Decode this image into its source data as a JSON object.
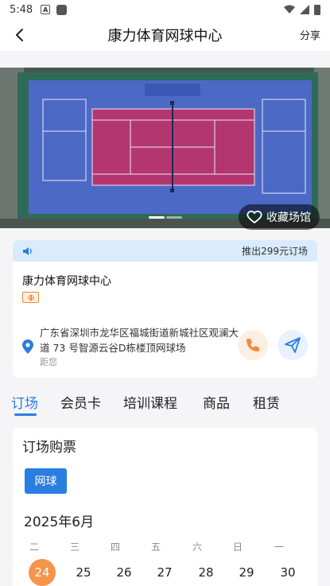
{
  "status_bar": {
    "time": "5:48",
    "a_icon": "A"
  },
  "nav": {
    "title": "康力体育网球中心",
    "share": "分享"
  },
  "banner": {
    "favorite_label": "收藏场馆",
    "slide_current": 1,
    "slide_total": 2
  },
  "notice": {
    "text": "推出299元订场"
  },
  "venue": {
    "name": "康力体育网球中心",
    "address": "广东省深圳市龙华区福城街道新城社区观澜大道 73 号智源云谷D栋楼顶网球场",
    "distance": "距您"
  },
  "tabs": [
    {
      "label": "订场",
      "active": true
    },
    {
      "label": "会员卡"
    },
    {
      "label": "培训课程"
    },
    {
      "label": "商品"
    },
    {
      "label": "租赁"
    }
  ],
  "booking": {
    "title": "订场购票",
    "sport": "网球",
    "month": "2025年6月",
    "weekdays": [
      "二",
      "三",
      "四",
      "五",
      "六",
      "日",
      "一"
    ],
    "dates": [
      "24",
      "25",
      "26",
      "27",
      "28",
      "29",
      "30"
    ],
    "selected_date": "24"
  },
  "colors": {
    "accent": "#2a7de1",
    "orange": "#f5944b",
    "court_pink": "#b3366e",
    "court_blue": "#4a67c4"
  }
}
